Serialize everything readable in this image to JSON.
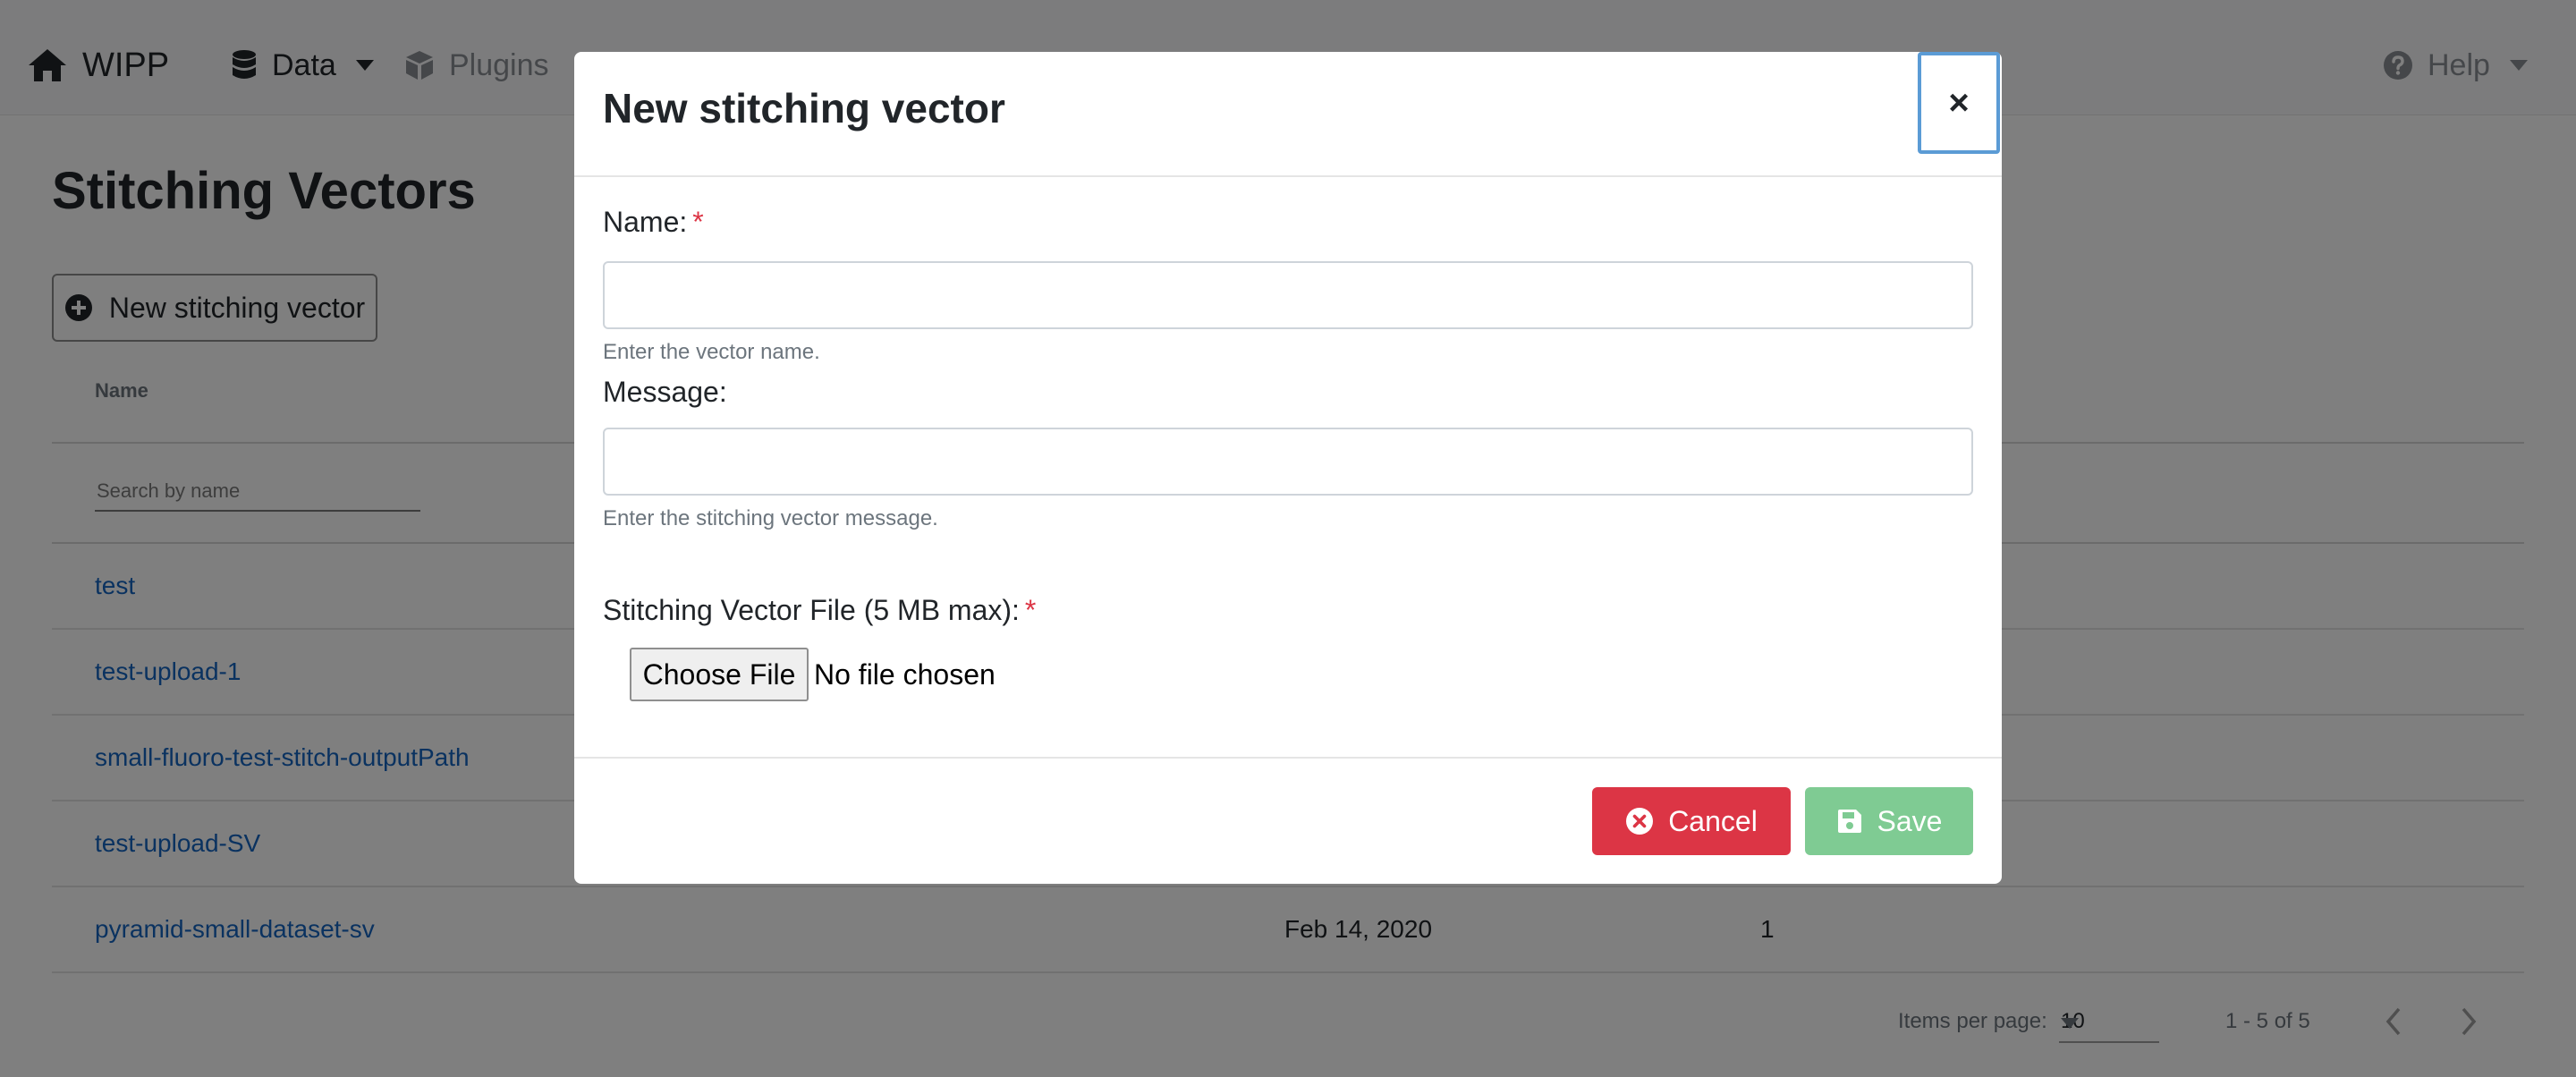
{
  "navbar": {
    "brand": "WIPP",
    "data_label": "Data",
    "plugins_label": "Plugins",
    "help_label": "Help"
  },
  "page": {
    "title": "Stitching Vectors",
    "new_button_label": "New stitching vector",
    "column_name": "Name",
    "search_placeholder": "Search by name",
    "rows": [
      {
        "name": "test",
        "date": "",
        "count": ""
      },
      {
        "name": "test-upload-1",
        "date": "",
        "count": ""
      },
      {
        "name": "small-fluoro-test-stitch-outputPath",
        "date": "",
        "count": ""
      },
      {
        "name": "test-upload-SV",
        "date": "",
        "count": ""
      },
      {
        "name": "pyramid-small-dataset-sv",
        "date": "Feb 14, 2020",
        "count": "1"
      }
    ]
  },
  "paginator": {
    "items_per_page_label": "Items per page:",
    "items_per_page_value": "10",
    "range_label": "1 - 5 of 5"
  },
  "modal": {
    "title": "New stitching vector",
    "close_symbol": "×",
    "name_label": "Name:",
    "required_mark": "*",
    "name_value": "",
    "name_help": "Enter the vector name.",
    "message_label": "Message:",
    "message_value": "",
    "message_help": "Enter the stitching vector message.",
    "file_label": "Stitching Vector File (5 MB max):",
    "file_button_label": "Choose File",
    "file_status": "No file chosen",
    "cancel_label": "Cancel",
    "save_label": "Save"
  },
  "colors": {
    "link": "#1565c0",
    "cancel": "#dc3545",
    "save_disabled": "#7fcb93",
    "focus_ring": "#5b9bd5"
  }
}
